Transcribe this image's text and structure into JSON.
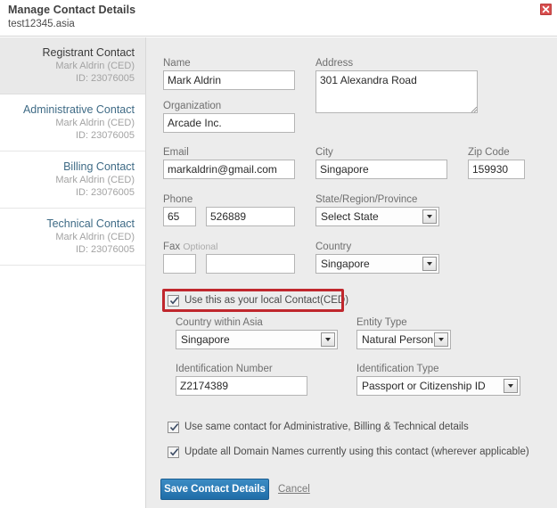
{
  "header": {
    "title": "Manage Contact Details",
    "domain": "test12345.asia",
    "close_icon": "close-icon"
  },
  "sidebar": {
    "items": [
      {
        "title": "Registrant Contact",
        "name": "Mark Aldrin (CED)",
        "id": "ID: 23076005",
        "selected": true
      },
      {
        "title": "Administrative Contact",
        "name": "Mark Aldrin (CED)",
        "id": "ID: 23076005",
        "selected": false
      },
      {
        "title": "Billing Contact",
        "name": "Mark Aldrin (CED)",
        "id": "ID: 23076005",
        "selected": false
      },
      {
        "title": "Technical Contact",
        "name": "Mark Aldrin (CED)",
        "id": "ID: 23076005",
        "selected": false
      }
    ]
  },
  "form": {
    "name": {
      "label": "Name",
      "value": "Mark Aldrin"
    },
    "organization": {
      "label": "Organization",
      "value": "Arcade Inc."
    },
    "email": {
      "label": "Email",
      "value": "markaldrin@gmail.com"
    },
    "phone": {
      "label": "Phone",
      "code": "65",
      "number": "526889"
    },
    "fax": {
      "label": "Fax",
      "optional": "Optional",
      "code": "",
      "number": ""
    },
    "address": {
      "label": "Address",
      "value": "301 Alexandra Road"
    },
    "city": {
      "label": "City",
      "value": "Singapore"
    },
    "zip": {
      "label": "Zip Code",
      "value": "159930"
    },
    "state": {
      "label": "State/Region/Province",
      "value": "Select State"
    },
    "country": {
      "label": "Country",
      "value": "Singapore"
    },
    "local_contact_checkbox": {
      "label": "Use this as your local Contact(CED)",
      "checked": true
    },
    "country_within_asia": {
      "label": "Country within Asia",
      "value": "Singapore"
    },
    "entity_type": {
      "label": "Entity Type",
      "value": "Natural Person"
    },
    "identification_number": {
      "label": "Identification Number",
      "value": "Z2174389"
    },
    "identification_type": {
      "label": "Identification Type",
      "value": "Passport or Citizenship ID"
    },
    "same_contact_checkbox": {
      "label": "Use same contact for Administrative, Billing & Technical details",
      "checked": true
    },
    "update_domains_checkbox": {
      "label": "Update all Domain Names currently using this contact (wherever applicable)",
      "checked": true
    },
    "save_button": "Save Contact Details",
    "cancel_link": "Cancel"
  },
  "colors": {
    "accent_blue": "#2472ab",
    "annotation_red": "#c0272d",
    "panel_gray": "#ececec",
    "label_gray": "#6f6f6f",
    "link_blue": "#3f6b86"
  }
}
